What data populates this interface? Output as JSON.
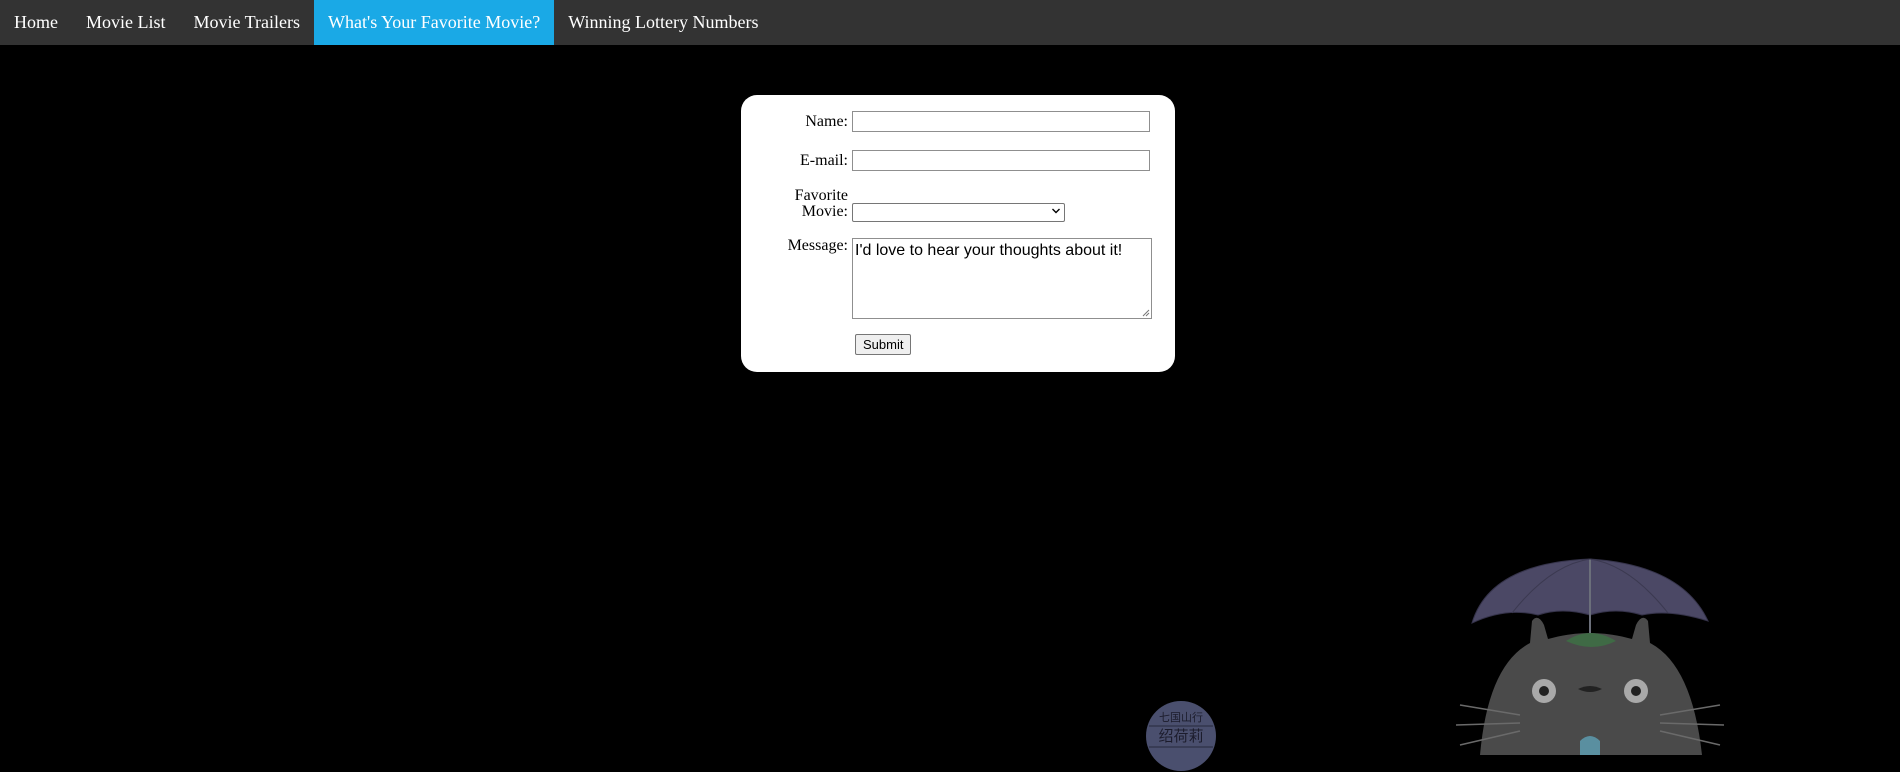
{
  "nav": {
    "items": [
      {
        "label": "Home",
        "active": false
      },
      {
        "label": "Movie List",
        "active": false
      },
      {
        "label": "Movie Trailers",
        "active": false
      },
      {
        "label": "What's Your Favorite Movie?",
        "active": true
      },
      {
        "label": "Winning Lottery Numbers",
        "active": false
      }
    ],
    "bar_color": "#333333",
    "active_color": "#1aa9e6"
  },
  "form": {
    "name_label": "Name:",
    "name_value": "",
    "email_label": "E-mail:",
    "email_value": "",
    "movie_label_line1": "Favorite",
    "movie_label_line2": "Movie:",
    "movie_selected": "",
    "message_label": "Message:",
    "message_value": "I'd love to hear your thoughts about it!",
    "submit_label": "Submit"
  },
  "background": {
    "color": "#000000",
    "illustration": "totoro-with-umbrella",
    "seal_text_top": "七国山行",
    "seal_text_middle": "绍荷莉"
  }
}
